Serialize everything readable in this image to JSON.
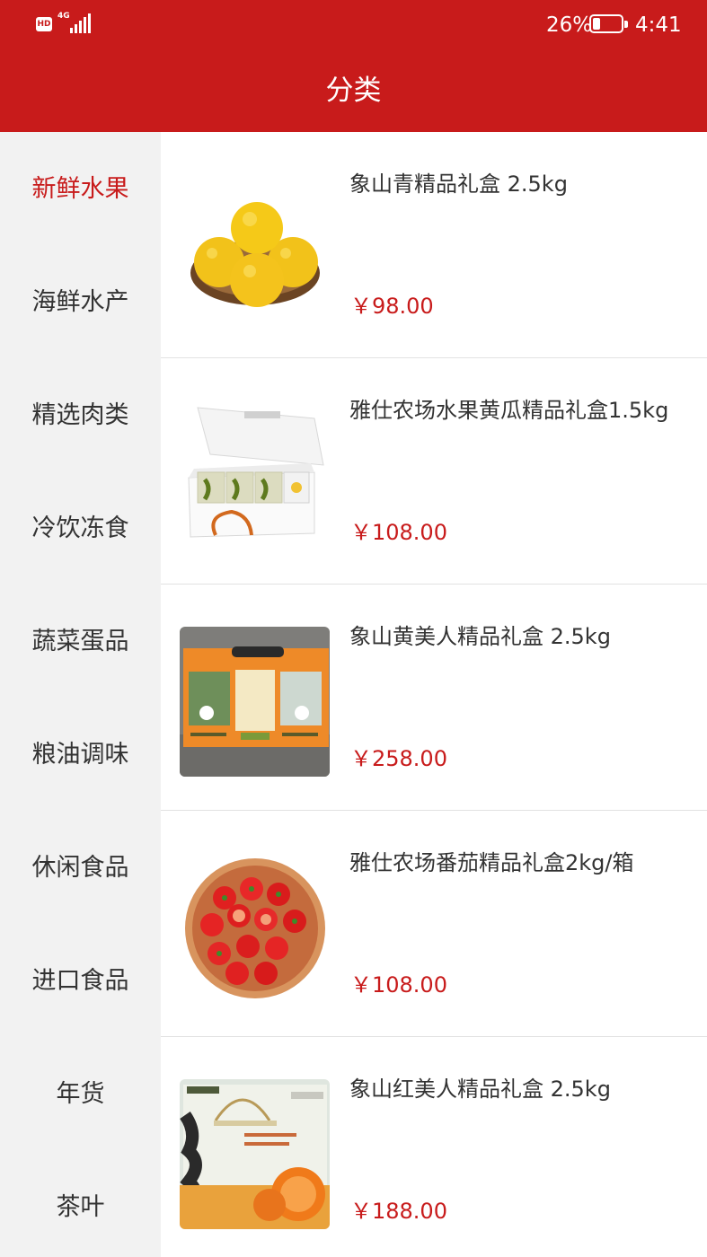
{
  "status_bar": {
    "hd": "HD",
    "network": "4G",
    "battery_percent": "26%",
    "battery_level": 0.26,
    "time": "4:41"
  },
  "header": {
    "title": "分类"
  },
  "colors": {
    "brand_red": "#c81b1b",
    "sidebar_bg": "#f2f2f2",
    "text": "#333333"
  },
  "categories": [
    {
      "label": "新鲜水果",
      "active": true
    },
    {
      "label": "海鲜水产",
      "active": false
    },
    {
      "label": "精选肉类",
      "active": false
    },
    {
      "label": "冷饮冻食",
      "active": false
    },
    {
      "label": "蔬菜蛋品",
      "active": false
    },
    {
      "label": "粮油调味",
      "active": false
    },
    {
      "label": "休闲食品",
      "active": false
    },
    {
      "label": "进口食品",
      "active": false
    },
    {
      "label": "年货",
      "active": false
    },
    {
      "label": "茶叶",
      "active": false
    }
  ],
  "products": [
    {
      "name": "象山青精品礼盒  2.5kg",
      "price": "￥98.00",
      "image": "yellow-citrus-basket"
    },
    {
      "name": "雅仕农场水果黄瓜精品礼盒1.5kg",
      "price": "￥108.00",
      "image": "white-gift-box"
    },
    {
      "name": "象山黄美人精品礼盒 2.5kg",
      "price": "￥258.00",
      "image": "orange-gift-box"
    },
    {
      "name": "雅仕农场番茄精品礼盒2kg/箱",
      "price": "￥108.00",
      "image": "cherry-tomato-bowl"
    },
    {
      "name": "象山红美人精品礼盒 2.5kg",
      "price": "￥188.00",
      "image": "red-beauty-gift-box"
    }
  ]
}
